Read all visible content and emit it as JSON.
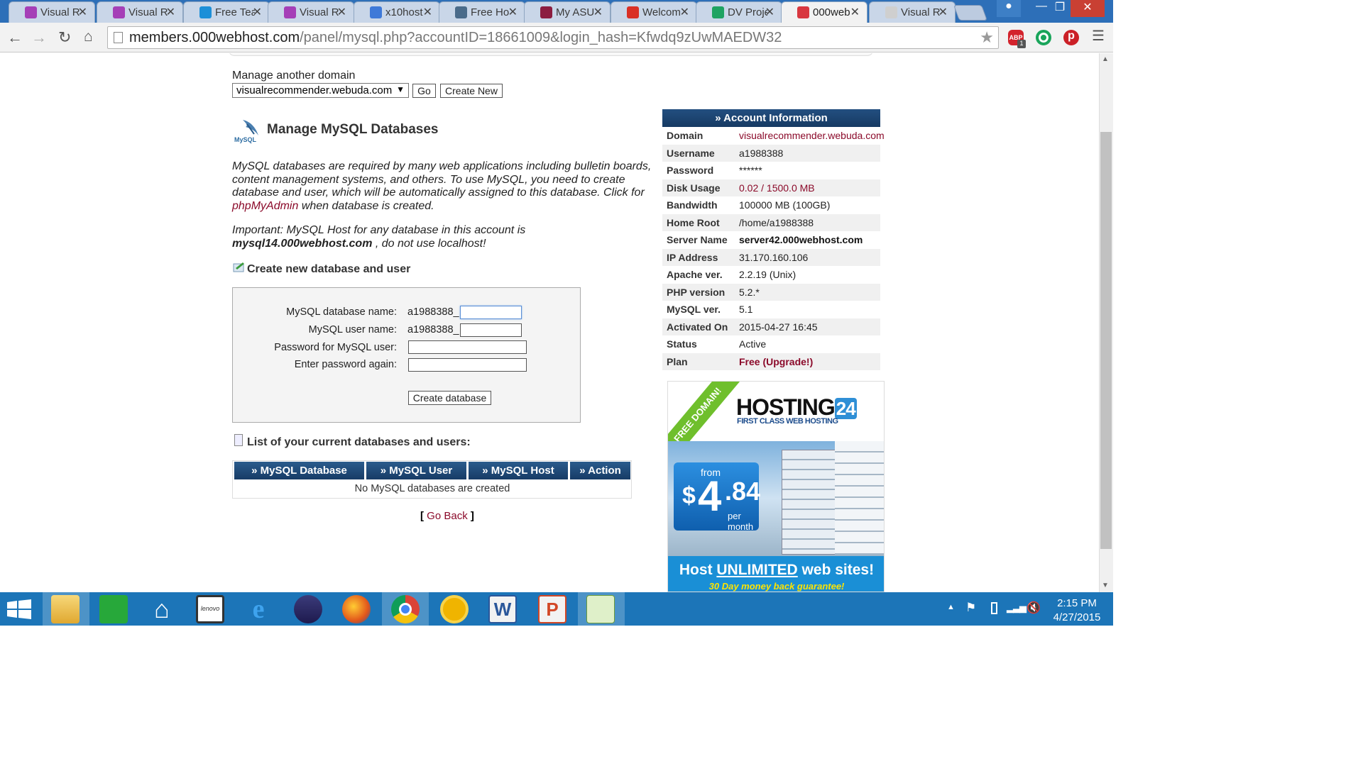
{
  "browser": {
    "tabs": [
      {
        "label": "Visual R",
        "color": "#a53fb7"
      },
      {
        "label": "Visual R",
        "color": "#a53fb7"
      },
      {
        "label": "Free Tea",
        "color": "#1c8fd8"
      },
      {
        "label": "Visual R",
        "color": "#a53fb7"
      },
      {
        "label": "x10host",
        "color": "#3e79d8"
      },
      {
        "label": "Free Ho",
        "color": "#4a6b8a"
      },
      {
        "label": "My ASU",
        "color": "#8c1d40"
      },
      {
        "label": "Welcom",
        "color": "#d93025"
      },
      {
        "label": "DV Proje",
        "color": "#1ea362"
      },
      {
        "label": "000web",
        "color": "#d8373f"
      },
      {
        "label": "Visual R",
        "color": "#cfcfcf"
      }
    ],
    "active_tab_index": 9,
    "url_host": "members.000webhost.com",
    "url_path": "/panel/mysql.php?accountID=18661009&login_hash=Kfwdq9zUwMAEDW32",
    "extensions": {
      "adblock_label": "ABP",
      "adblock_badge": "1"
    }
  },
  "page": {
    "manage_label": "Manage another domain",
    "domain_select": "visualrecommender.webuda.com",
    "go_button": "Go",
    "create_new_button": "Create New",
    "mysql_logo_text": "MySQL",
    "title": "Manage MySQL Databases",
    "para1_a": "MySQL databases are required by many web applications including bulletin boards, content management systems, and others. To use MySQL, you need to create database and user, which will be automatically assigned to this database. Click for ",
    "para1_link": "phpMyAdmin",
    "para1_b": " when database is created.",
    "para2_a": "Important: MySQL Host for any database in this account is ",
    "para2_host": "mysql14.000webhost.com",
    "para2_b": " , do not use localhost!",
    "create_heading": "Create new database and user",
    "form": {
      "db_name_label": "MySQL database name:",
      "user_name_label": "MySQL user name:",
      "password_label": "Password for MySQL user:",
      "password_again_label": "Enter password again:",
      "prefix": "a1988388_",
      "submit": "Create database"
    },
    "list_heading": "List of your current databases and users:",
    "table": {
      "headers": [
        "» MySQL Database",
        "» MySQL User",
        "» MySQL Host",
        "» Action"
      ],
      "empty": "No MySQL databases are created"
    },
    "go_back_open": "[",
    "go_back": "Go Back",
    "go_back_close": "]"
  },
  "account": {
    "heading": "» Account Information",
    "rows": [
      {
        "k": "Domain",
        "v": "visualrecommender.webuda.com"
      },
      {
        "k": "Username",
        "v": "a1988388"
      },
      {
        "k": "Password",
        "v": "******"
      },
      {
        "k": "Disk Usage",
        "v": "0.02 / 1500.0 MB"
      },
      {
        "k": "Bandwidth",
        "v": "100000 MB (100GB)"
      },
      {
        "k": "Home Root",
        "v": "/home/a1988388"
      },
      {
        "k": "Server Name",
        "v": "server42.000webhost.com"
      },
      {
        "k": "IP Address",
        "v": "31.170.160.106"
      },
      {
        "k": "Apache ver.",
        "v": "2.2.19 (Unix)"
      },
      {
        "k": "PHP version",
        "v": "5.2.*"
      },
      {
        "k": "MySQL ver.",
        "v": "5.1"
      },
      {
        "k": "Activated On",
        "v": "2015-04-27 16:45"
      },
      {
        "k": "Status",
        "v": "Active"
      },
      {
        "k": "Plan",
        "v": "Free (Upgrade!)"
      }
    ]
  },
  "ad": {
    "ribbon": "FREE DOMAIN!",
    "brand": "HOSTING",
    "brand_num": "24",
    "tagline": "FIRST CLASS WEB HOSTING",
    "from": "from",
    "price_dollar": "$",
    "price_int": "4",
    "price_dec": ".84",
    "per_month": "per month",
    "headline_a": "Host ",
    "headline_b": "UNLIMITED",
    "headline_c": " web sites!",
    "guarantee": "30 Day money back guarantee!"
  },
  "taskbar": {
    "time": "2:15 PM",
    "date": "4/27/2015",
    "lenovo_label": "lenovo"
  },
  "colors": {
    "link": "#8b0a2a",
    "header_blue": "#1c4673",
    "taskbar": "#1c75b8"
  }
}
